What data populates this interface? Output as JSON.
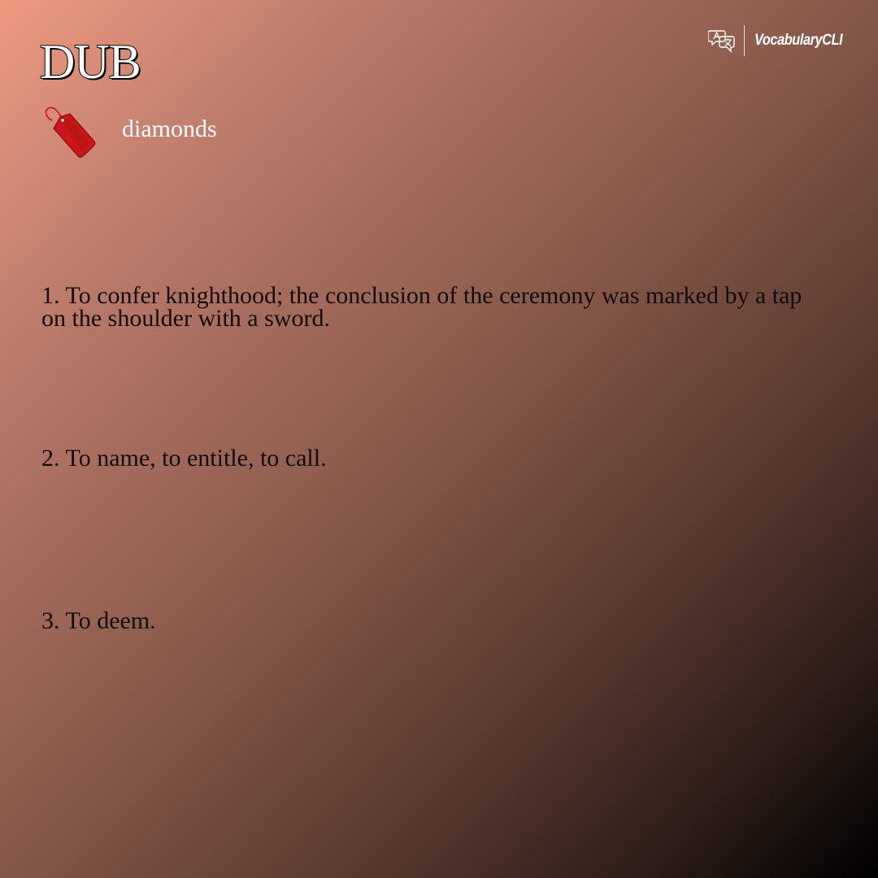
{
  "brand": {
    "name": "VocabularyCLI",
    "icon": "translate-icon"
  },
  "entry": {
    "word": "DUB",
    "category": "diamonds",
    "category_icon": "price-tag-icon",
    "definitions": [
      "1. To confer knighthood; the conclusion of the ceremony was marked by a tap on the shoulder with a sword.",
      "2. To name, to entitle, to call.",
      "3. To deem."
    ]
  },
  "colors": {
    "gradient_start": "#ee9a80",
    "gradient_end": "#000000",
    "tag_red": "#c8161b",
    "definition_text": "#140b08"
  }
}
